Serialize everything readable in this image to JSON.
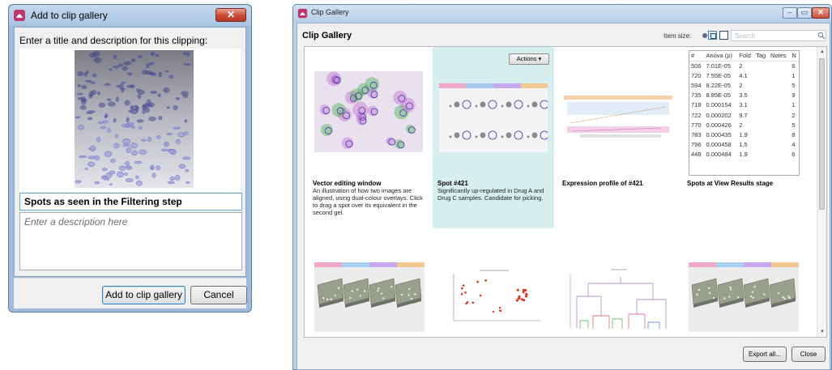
{
  "dialog": {
    "title": "Add to clip gallery",
    "close_glyph": "✕",
    "prompt": "Enter a title and description for this clipping:",
    "title_value": "Spots as seen in the Filtering step",
    "description_placeholder": "Enter a description here",
    "add_button": "Add to clip gallery",
    "cancel_button": "Cancel"
  },
  "gallery": {
    "window_title": "Clip Gallery",
    "heading": "Clip Gallery",
    "item_size_label": "Item size:",
    "search_placeholder": "Search",
    "window_controls": {
      "minimize": "–",
      "maximize": "▭",
      "close": "✕"
    },
    "actions_label": "Actions ▾",
    "export_button": "Export all...",
    "close_button": "Close",
    "clips": [
      {
        "title": "Vector editing window",
        "description": "An illustration of how two images are aligned, using dual-colour overlays. Click to drag a spot over its equivalent in the second gel."
      },
      {
        "title": "Spot #421",
        "description": "Significantly up-regulated in Drug A and Drug C samples. Candidate for picking."
      },
      {
        "title": "Expression profile of #421",
        "description": ""
      },
      {
        "title": "Spots at View Results stage",
        "description": ""
      }
    ],
    "table": {
      "columns": [
        "#",
        "Anova (p)",
        "Fold",
        "Tag",
        "Notes",
        "N"
      ],
      "rows": [
        [
          "506",
          "7.01E-05",
          "2",
          "",
          "",
          "6"
        ],
        [
          "720",
          "7.55E-05",
          "4.1",
          "",
          "",
          "1"
        ],
        [
          "594",
          "8.22E-05",
          "2",
          "",
          "",
          "5"
        ],
        [
          "735",
          "8.85E-05",
          "3.5",
          "",
          "",
          "9"
        ],
        [
          "718",
          "0.000154",
          "3.1",
          "",
          "",
          "1"
        ],
        [
          "722",
          "0.000202",
          "9.7",
          "",
          "",
          "2"
        ],
        [
          "770",
          "0.000426",
          "2",
          "",
          "",
          "5"
        ],
        [
          "783",
          "0.000435",
          "1.9",
          "",
          "",
          "8"
        ],
        [
          "796",
          "0.000458",
          "1.5",
          "",
          "",
          "4"
        ],
        [
          "448",
          "0.000484",
          "1.9",
          "",
          "",
          "6"
        ]
      ]
    }
  },
  "colors": {
    "selected_card": "#d7eeee",
    "spot_purple": "#6a4fd8",
    "app_icon": "#c0356a"
  }
}
